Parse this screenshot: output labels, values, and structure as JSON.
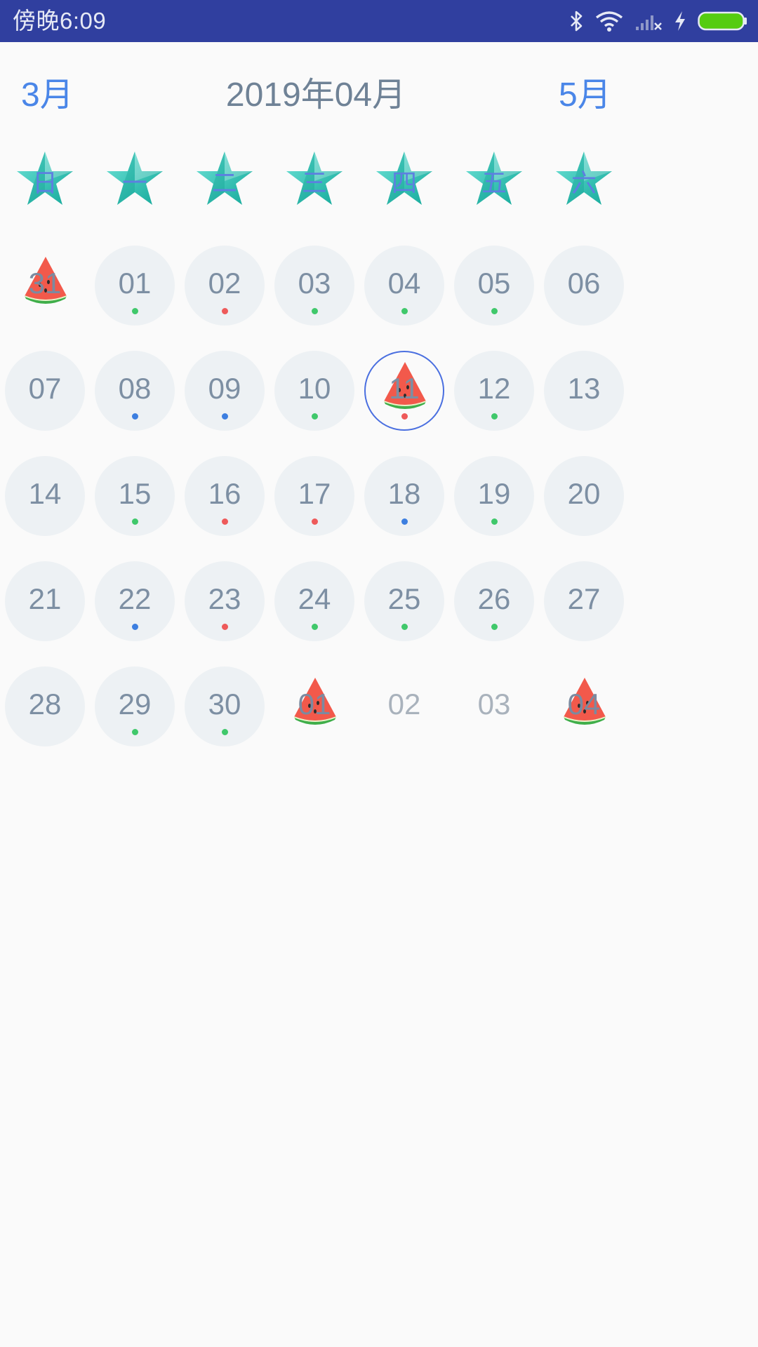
{
  "status_bar": {
    "time": "傍晚6:09",
    "icons": [
      "bluetooth-icon",
      "wifi-icon",
      "signal-icon",
      "charging-icon",
      "battery-icon"
    ],
    "colors": {
      "background": "#303f9f",
      "battery": "#55cc11"
    }
  },
  "header": {
    "prev_month": "3月",
    "current_month": "2019年04月",
    "next_month": "5月"
  },
  "weekdays": [
    "日",
    "一",
    "二",
    "三",
    "四",
    "五",
    "六"
  ],
  "colors": {
    "accent": "#4a86e8",
    "dot_green": "#40c86b",
    "dot_red": "#ee5a5a",
    "dot_blue": "#3d7fe0",
    "star": "#27c2b3"
  },
  "calendar": {
    "weeks": [
      [
        {
          "day": "31",
          "other_month": true,
          "icon": "watermelon-icon",
          "dot": null
        },
        {
          "day": "01",
          "dot": "green"
        },
        {
          "day": "02",
          "dot": "red"
        },
        {
          "day": "03",
          "dot": "green"
        },
        {
          "day": "04",
          "dot": "green"
        },
        {
          "day": "05",
          "dot": "green"
        },
        {
          "day": "06",
          "dot": null
        }
      ],
      [
        {
          "day": "07",
          "dot": null
        },
        {
          "day": "08",
          "dot": "blue"
        },
        {
          "day": "09",
          "dot": "blue"
        },
        {
          "day": "10",
          "dot": "green"
        },
        {
          "day": "11",
          "selected": true,
          "icon": "watermelon-icon",
          "dot": "red"
        },
        {
          "day": "12",
          "dot": "green"
        },
        {
          "day": "13",
          "dot": null
        }
      ],
      [
        {
          "day": "14",
          "dot": null
        },
        {
          "day": "15",
          "dot": "green"
        },
        {
          "day": "16",
          "dot": "red"
        },
        {
          "day": "17",
          "dot": "red"
        },
        {
          "day": "18",
          "dot": "blue"
        },
        {
          "day": "19",
          "dot": "green"
        },
        {
          "day": "20",
          "dot": null
        }
      ],
      [
        {
          "day": "21",
          "dot": null
        },
        {
          "day": "22",
          "dot": "blue"
        },
        {
          "day": "23",
          "dot": "red"
        },
        {
          "day": "24",
          "dot": "green"
        },
        {
          "day": "25",
          "dot": "green"
        },
        {
          "day": "26",
          "dot": "green"
        },
        {
          "day": "27",
          "dot": null
        }
      ],
      [
        {
          "day": "28",
          "dot": null
        },
        {
          "day": "29",
          "dot": "green"
        },
        {
          "day": "30",
          "dot": "green"
        },
        {
          "day": "01",
          "other_month": true,
          "icon": "watermelon-icon",
          "dot": null
        },
        {
          "day": "02",
          "other_month": true,
          "dot": null
        },
        {
          "day": "03",
          "other_month": true,
          "dot": null
        },
        {
          "day": "04",
          "other_month": true,
          "icon": "watermelon-icon",
          "dot": null
        }
      ]
    ]
  }
}
